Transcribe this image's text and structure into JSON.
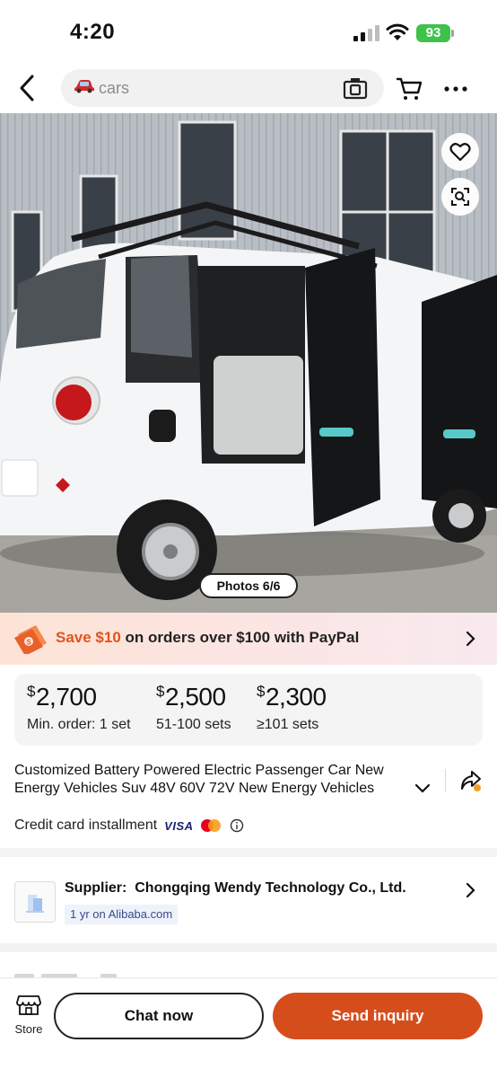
{
  "status_bar": {
    "time": "4:20",
    "battery_percent": "93"
  },
  "nav": {
    "search_query": "cars",
    "icons": [
      "back-arrow-icon",
      "car-icon",
      "camera-search-icon",
      "cart-icon",
      "more-icon"
    ]
  },
  "gallery": {
    "photo_counter": "Photos 6/6",
    "icons": [
      "heart-icon",
      "image-search-icon"
    ]
  },
  "promo": {
    "highlight": "Save $10",
    "rest": " on orders over $100 with PayPal"
  },
  "price_tiers": [
    {
      "currency": "$",
      "amount": "2,700",
      "qty": "Min. order: 1 set"
    },
    {
      "currency": "$",
      "amount": "2,500",
      "qty": "51-100 sets"
    },
    {
      "currency": "$",
      "amount": "2,300",
      "qty": "≥101 sets"
    }
  ],
  "product": {
    "title": "Customized Battery Powered Electric Passenger Car New Energy Vehicles Suv 48V 60V 72V New Energy Vehicles"
  },
  "payment": {
    "label": "Credit card installment",
    "visa": "VISA"
  },
  "supplier": {
    "label": "Supplier:",
    "name": "Chongqing Wendy Technology Co., Ltd.",
    "tenure": "1 yr on Alibaba.com"
  },
  "bottom_bar": {
    "store_label": "Store",
    "chat_label": "Chat now",
    "inquiry_label": "Send inquiry"
  },
  "colors": {
    "accent": "#d64d1c",
    "promo_highlight": "#e2541c",
    "battery": "#3ec24a"
  }
}
